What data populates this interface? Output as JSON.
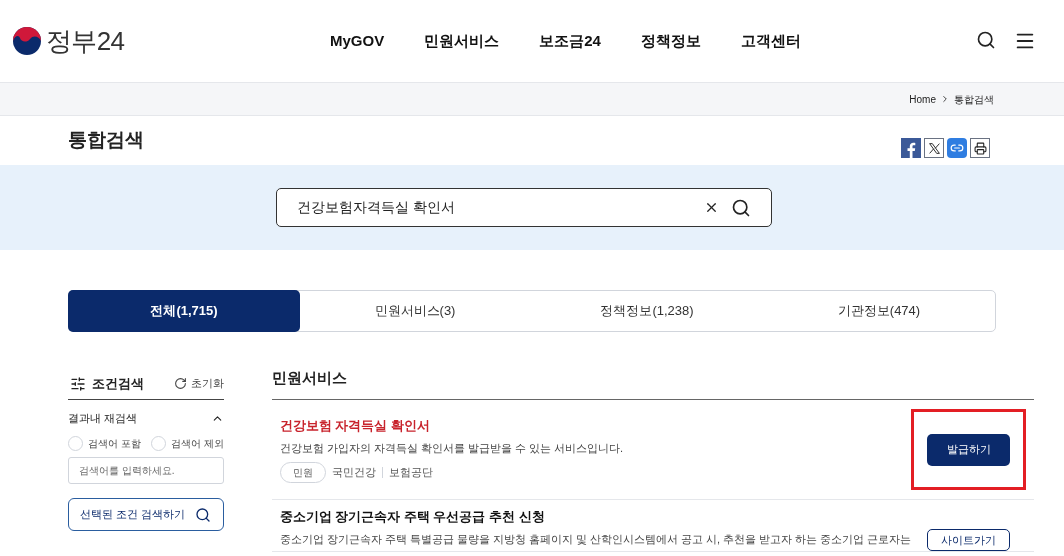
{
  "logo": {
    "text": "정부24"
  },
  "nav": [
    "MyGOV",
    "민원서비스",
    "보조금24",
    "정책정보",
    "고객센터"
  ],
  "breadcrumb": [
    "Home",
    "통합검색"
  ],
  "page_title": "통합검색",
  "share": [
    {
      "kind": "facebook"
    },
    {
      "kind": "x"
    },
    {
      "kind": "link"
    },
    {
      "kind": "print"
    }
  ],
  "search": {
    "value": "건강보험자격득실 확인서"
  },
  "tabs": [
    {
      "label": "전체(1,715)",
      "selected": true
    },
    {
      "label": "민원서비스(3)",
      "selected": false
    },
    {
      "label": "정책정보(1,238)",
      "selected": false
    },
    {
      "label": "기관정보(474)",
      "selected": false
    }
  ],
  "filter": {
    "title": "조건검색",
    "reset": "초기화",
    "section": "결과내 재검색",
    "expanded": true,
    "options": [
      {
        "label": "검색어 포함",
        "selected": false
      },
      {
        "label": "검색어 제외",
        "selected": false
      }
    ],
    "placeholder": "검색어를 입력하세요.",
    "submit": "선택된 조건 검색하기"
  },
  "results": {
    "heading": "민원서비스",
    "items": [
      {
        "title": "건강보험 자격득실 확인서",
        "highlighted": true,
        "description": "건강보험 가입자의 자격득실 확인서를 발급받을 수 있는 서비스입니다.",
        "tag": "민원",
        "orgs": [
          "국민건강",
          "보험공단"
        ],
        "action": {
          "label": "발급하기",
          "kind": "primary"
        },
        "marked": true
      },
      {
        "title": "중소기업 장기근속자 주택 우선공급 추천 신청",
        "highlighted": false,
        "description": "중소기업 장기근속자 주택 특별공급 물량을 지방청 홈페이지 및 산학인시스템에서 공고 시, 추천을 받고자 하는 중소기업 근로자는",
        "action": {
          "label": "사이트가기",
          "kind": "outline"
        },
        "marked": false
      }
    ]
  }
}
